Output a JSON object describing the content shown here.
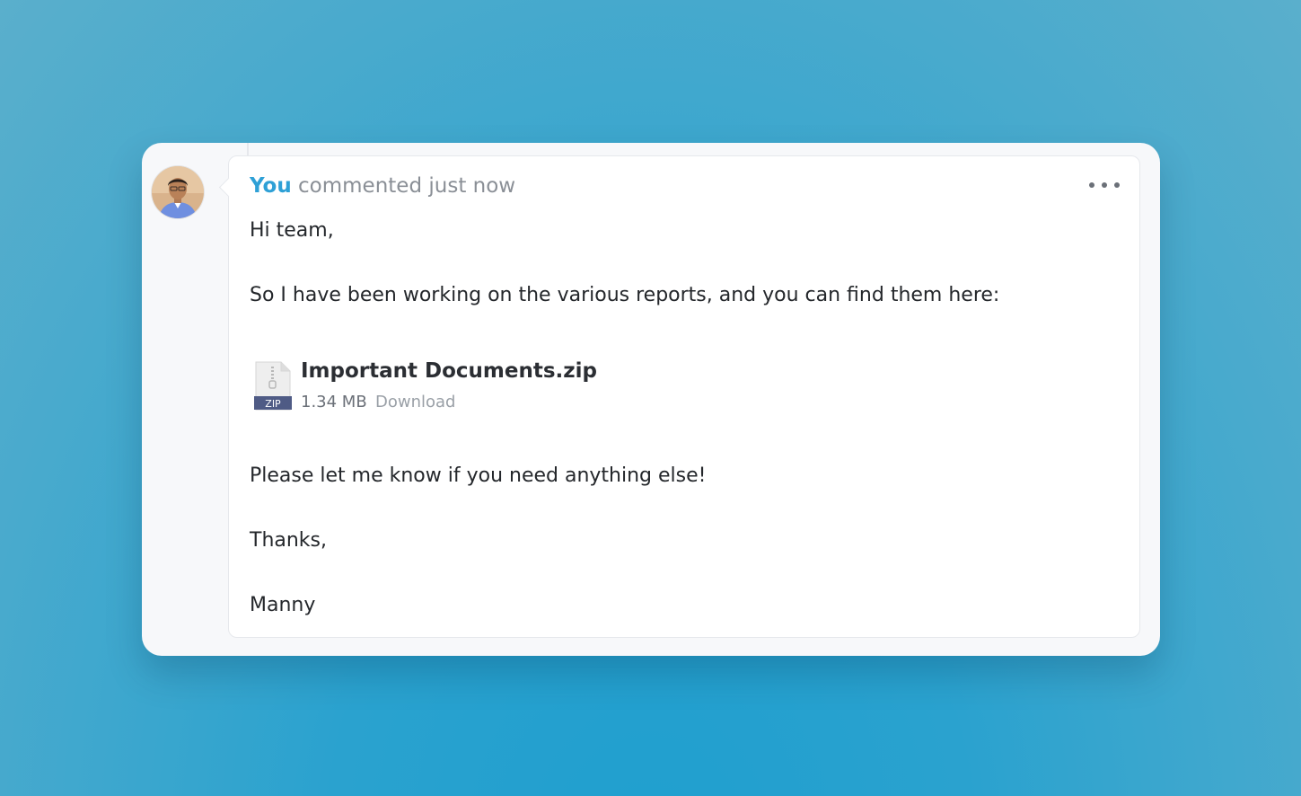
{
  "comment": {
    "author": "You",
    "meta": "commented just now",
    "menu_icon": "more-horizontal-icon",
    "lines": {
      "greeting": "Hi team,",
      "intro": "So I have been working on the various reports, and you can find them here:",
      "followup": "Please let me know if you need anything else!",
      "signoff": "Thanks,",
      "signature": "Manny"
    },
    "attachment": {
      "icon": "zip-file-icon",
      "type_badge": "ZIP",
      "file_name": "Important Documents.zip",
      "file_size": "1.34 MB",
      "download_label": "Download"
    }
  },
  "colors": {
    "author": "#2ea0d6",
    "badge": "#4f5b85",
    "background": "#2aa2cf"
  }
}
